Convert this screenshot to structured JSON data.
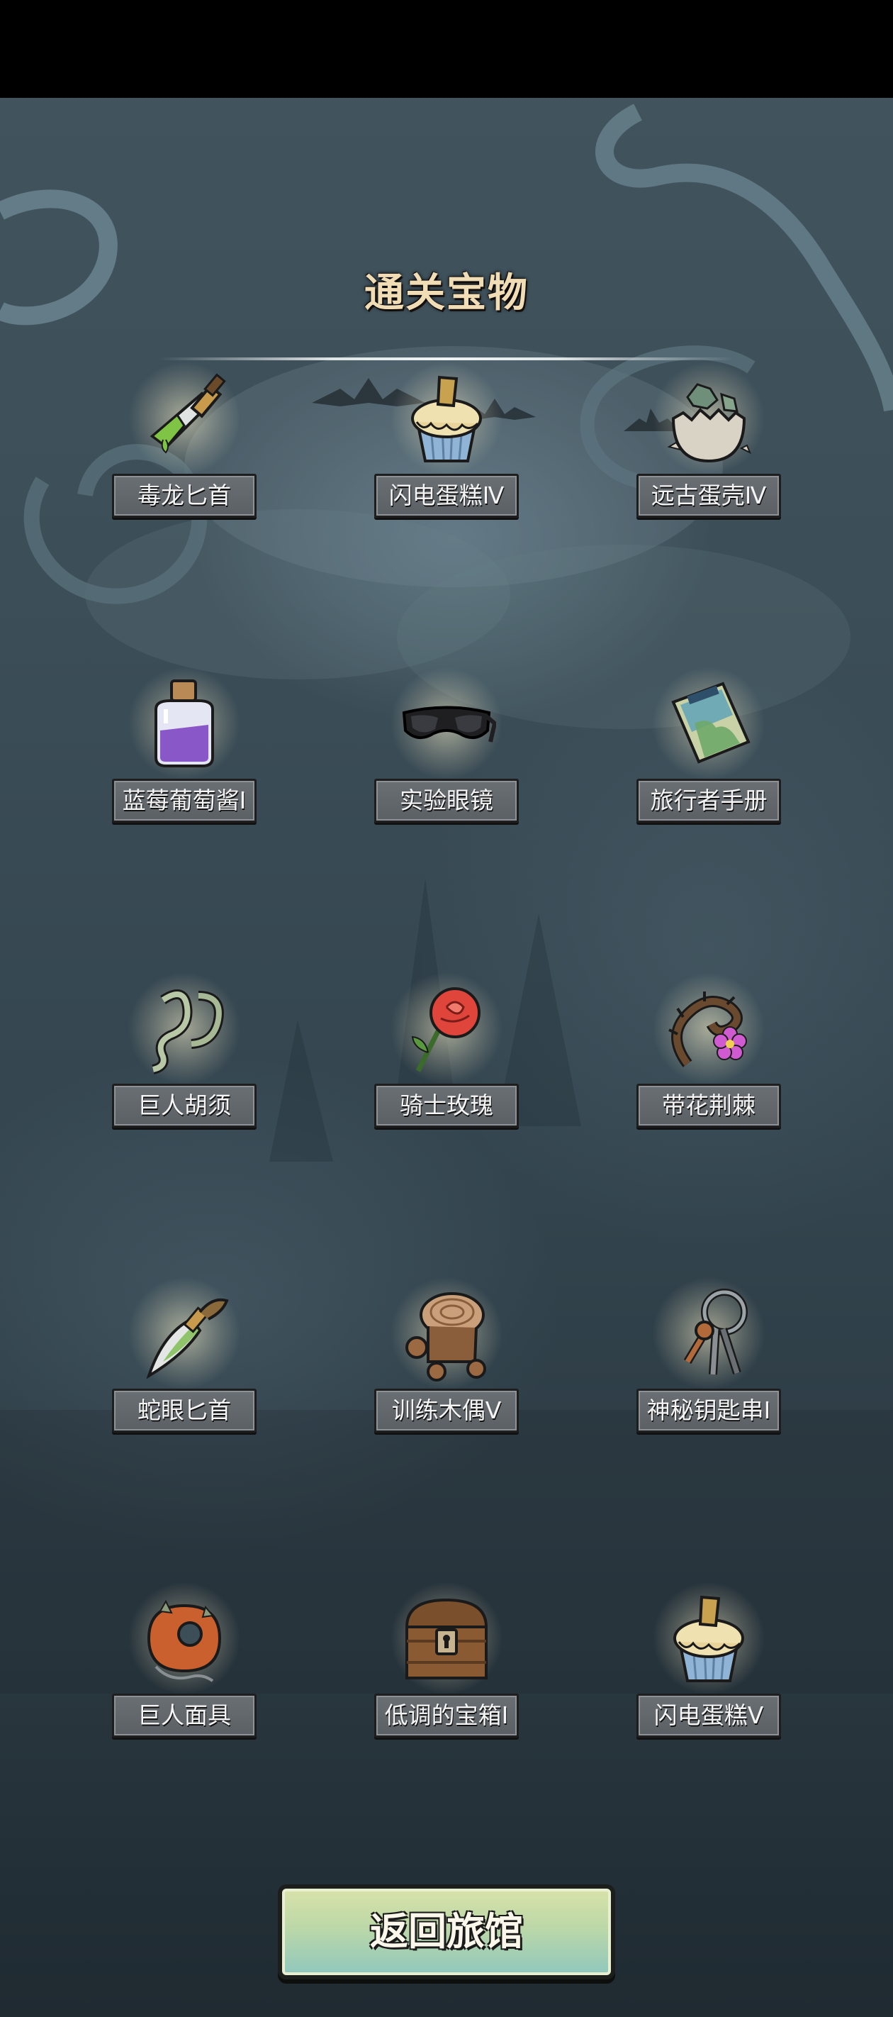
{
  "header": {
    "title": "通关宝物"
  },
  "items": [
    {
      "name": "毒龙匕首",
      "icon": "poison-dagger-icon"
    },
    {
      "name": "闪电蛋糕Ⅳ",
      "icon": "cupcake-icon"
    },
    {
      "name": "远古蛋壳Ⅳ",
      "icon": "eggshell-icon"
    },
    {
      "name": "蓝莓葡萄酱Ⅰ",
      "icon": "jam-jar-icon"
    },
    {
      "name": "实验眼镜",
      "icon": "goggles-icon"
    },
    {
      "name": "旅行者手册",
      "icon": "map-book-icon"
    },
    {
      "name": "巨人胡须",
      "icon": "beard-icon"
    },
    {
      "name": "骑士玫瑰",
      "icon": "rose-icon"
    },
    {
      "name": "带花荆棘",
      "icon": "thorn-flower-icon"
    },
    {
      "name": "蛇眼匕首",
      "icon": "curved-dagger-icon"
    },
    {
      "name": "训练木偶Ⅴ",
      "icon": "wooden-dummy-icon"
    },
    {
      "name": "神秘钥匙串Ⅰ",
      "icon": "key-ring-icon"
    },
    {
      "name": "巨人面具",
      "icon": "mask-icon"
    },
    {
      "name": "低调的宝箱Ⅰ",
      "icon": "treasure-chest-icon"
    },
    {
      "name": "闪电蛋糕Ⅴ",
      "icon": "cupcake-icon"
    }
  ],
  "footer": {
    "back_label": "返回旅馆"
  }
}
